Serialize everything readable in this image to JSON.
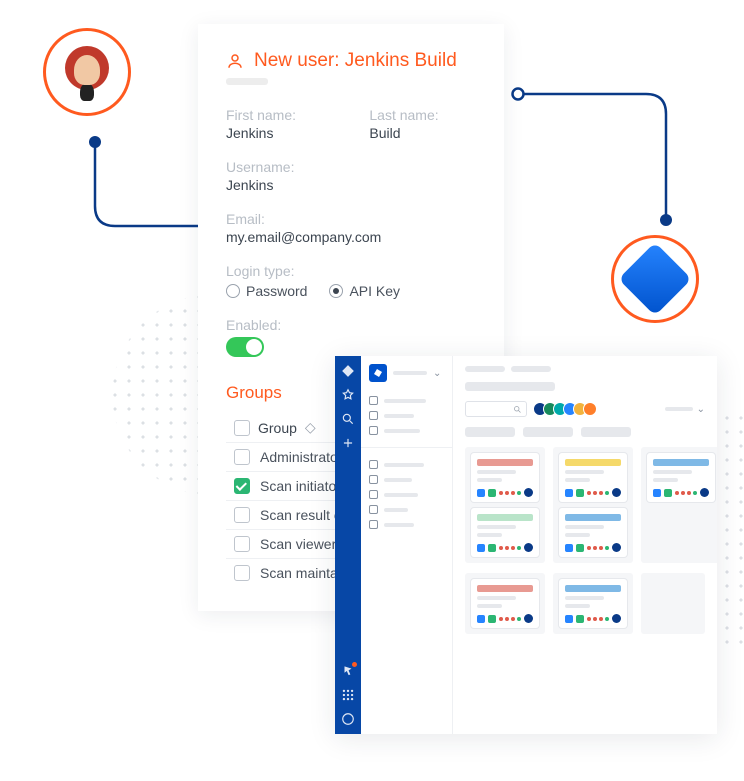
{
  "newUser": {
    "title": "New user: Jenkins Build",
    "firstNameLabel": "First name:",
    "firstName": "Jenkins",
    "lastNameLabel": "Last name:",
    "lastName": "Build",
    "usernameLabel": "Username:",
    "username": "Jenkins",
    "emailLabel": "Email:",
    "email": "my.email@company.com",
    "loginTypeLabel": "Login type:",
    "loginOptions": {
      "password": "Password",
      "apiKey": "API Key"
    },
    "loginSelected": "apiKey",
    "enabledLabel": "Enabled:",
    "enabled": true,
    "groupsTitle": "Groups",
    "groupHeader": "Group",
    "groups": [
      {
        "name": "Administrators",
        "checked": false
      },
      {
        "name": "Scan initiators",
        "checked": true
      },
      {
        "name": "Scan result editors",
        "checked": false
      },
      {
        "name": "Scan viewers",
        "checked": false
      },
      {
        "name": "Scan maintainers",
        "checked": false
      }
    ]
  },
  "board": {
    "avatarColors": [
      "#0a3a87",
      "#178a5c",
      "#0aa",
      "#2684ff",
      "#f2b33d",
      "#ff7f2a"
    ],
    "columns": [
      {
        "cards": [
          {
            "color": "b-red"
          },
          {
            "color": "b-mint"
          }
        ]
      },
      {
        "cards": [
          {
            "color": "b-yellow"
          },
          {
            "color": "b-blue"
          }
        ]
      },
      {
        "cards": [
          {
            "color": "b-blue"
          }
        ]
      }
    ],
    "columnsRow2": [
      {
        "cards": [
          {
            "color": "b-red"
          }
        ]
      },
      {
        "cards": [
          {
            "color": "b-blue"
          }
        ]
      },
      {
        "cards": []
      }
    ]
  }
}
